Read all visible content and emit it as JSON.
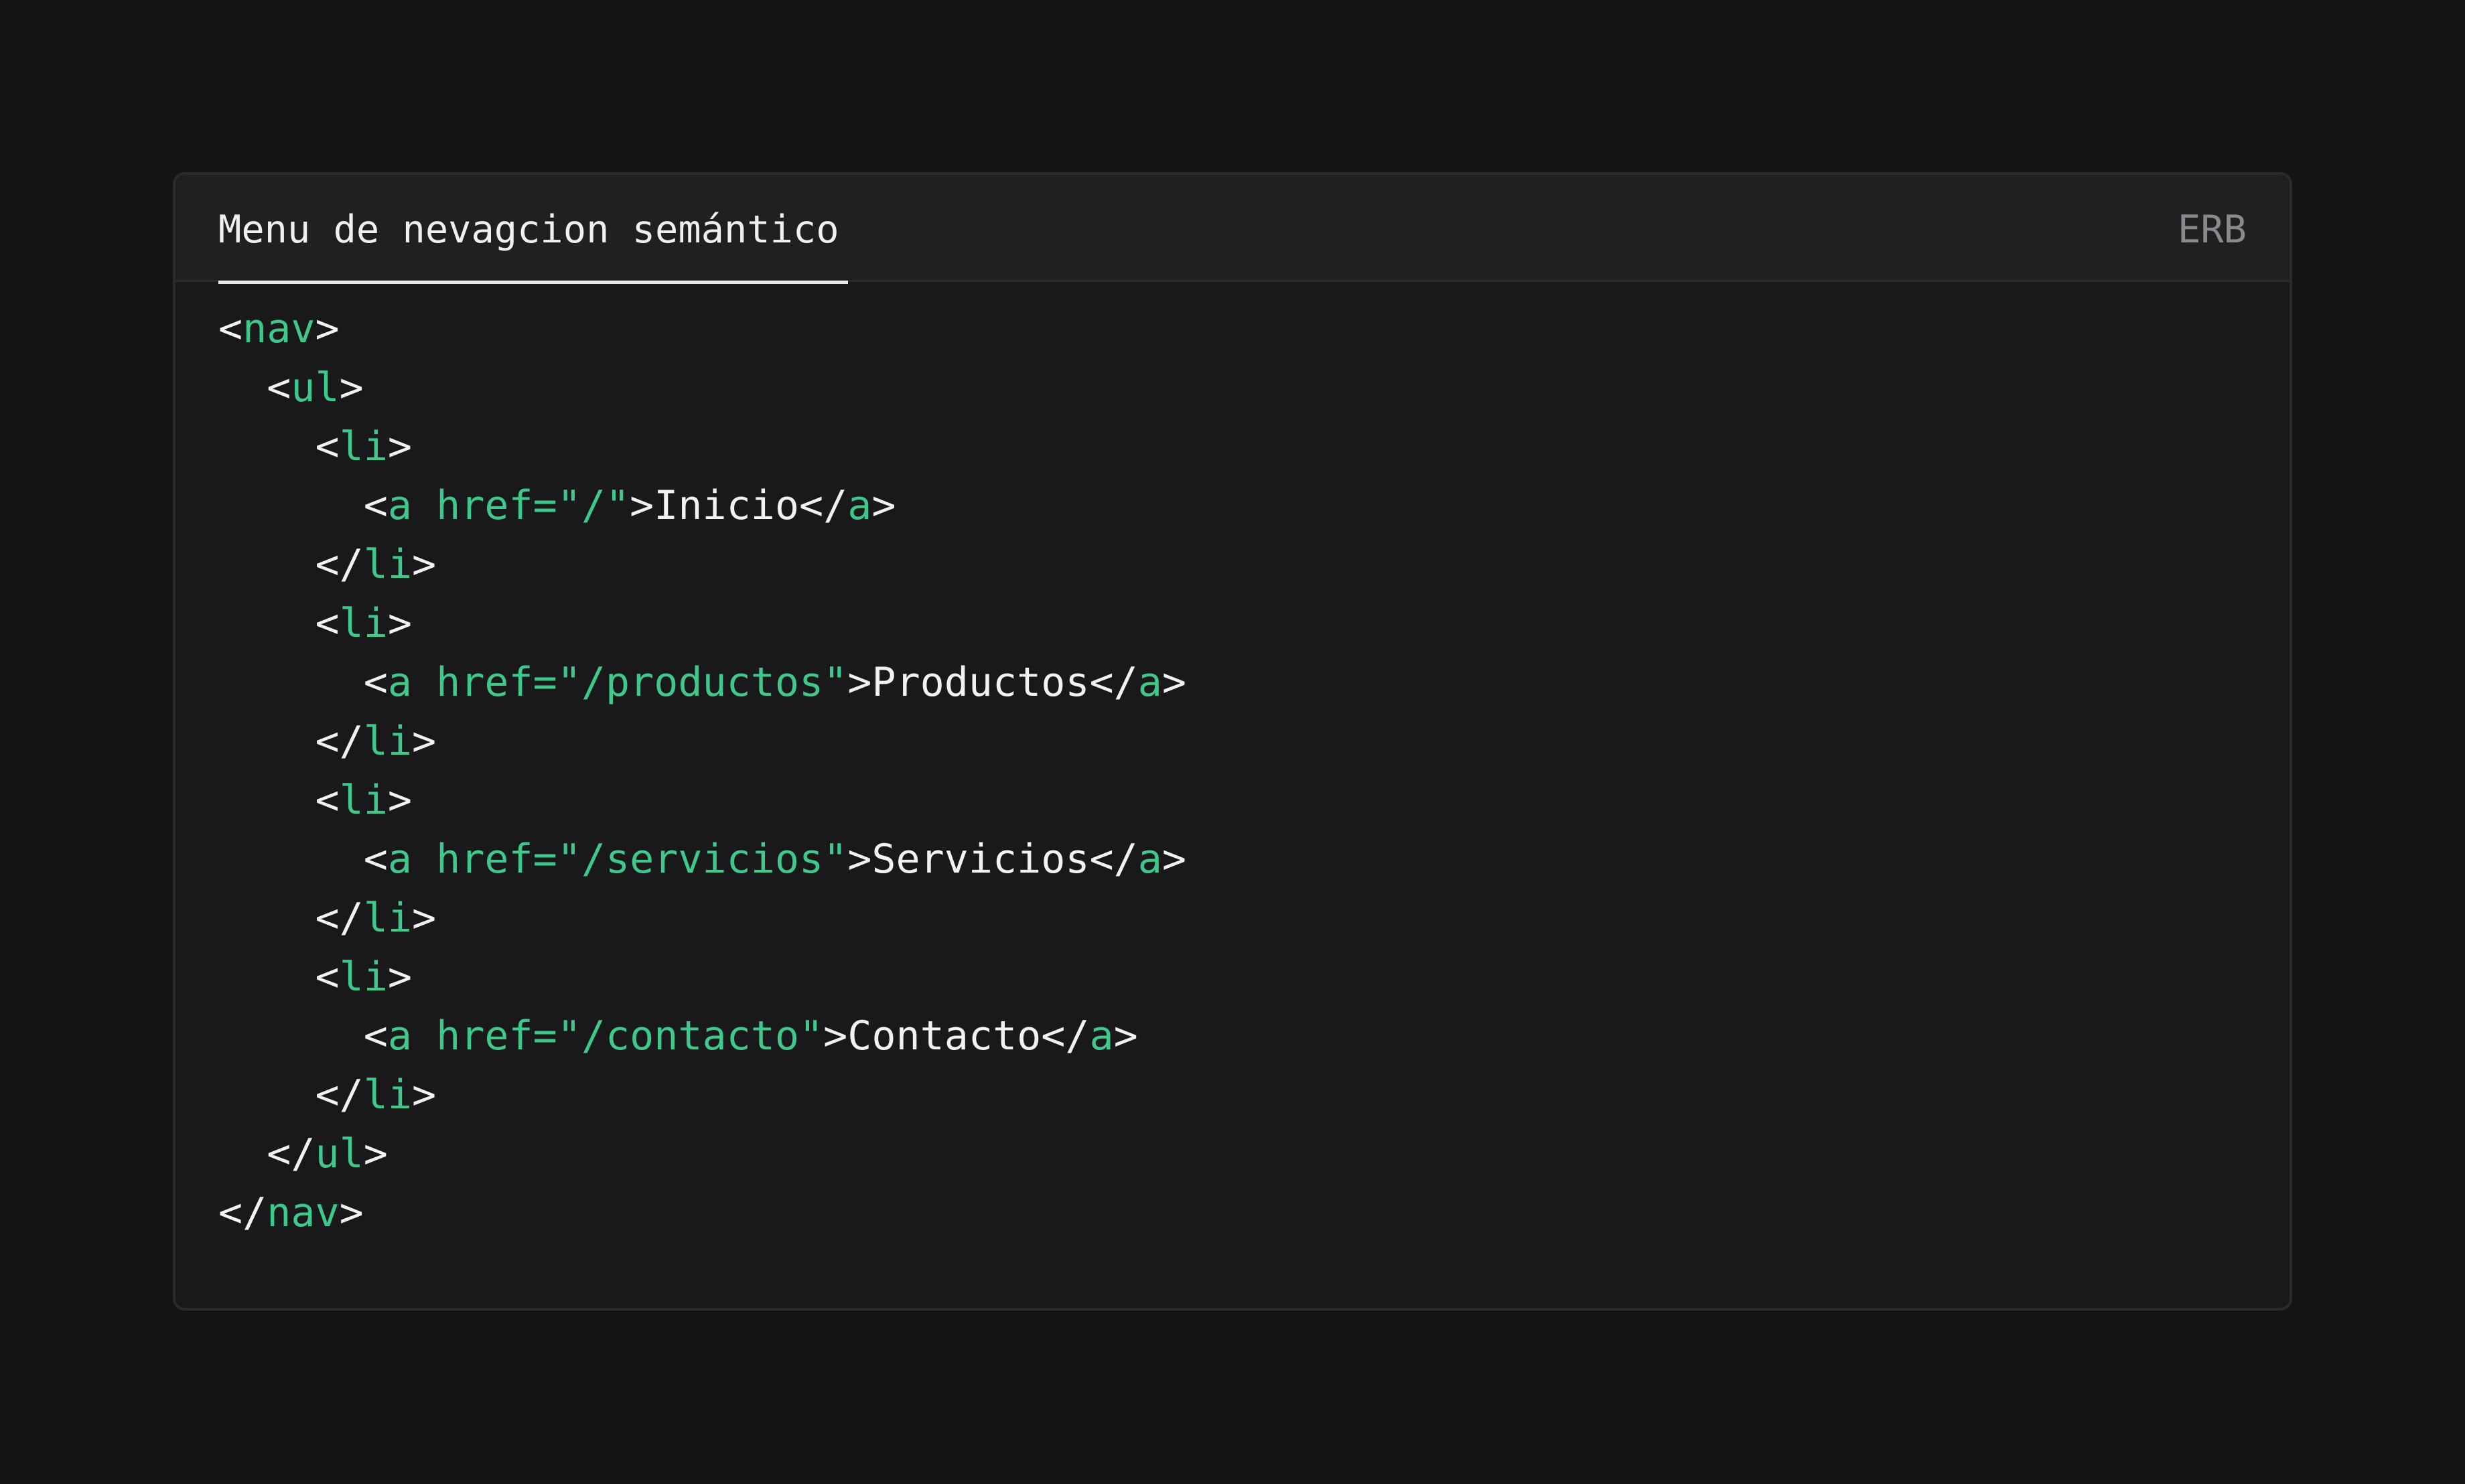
{
  "panel": {
    "title": "Menu de nevagcion semántico",
    "language": "ERB"
  },
  "colors": {
    "background": "#141316",
    "panel": "#19181b",
    "header": "#201f22",
    "tag": "#3ec98a",
    "text": "#f2f1f4",
    "muted": "#8a898e"
  },
  "code": {
    "lines": [
      [
        {
          "t": "p",
          "v": "<"
        },
        {
          "t": "tag",
          "v": "nav"
        },
        {
          "t": "p",
          "v": ">"
        }
      ],
      [
        {
          "t": "p",
          "v": "  <"
        },
        {
          "t": "tag",
          "v": "ul"
        },
        {
          "t": "p",
          "v": ">"
        }
      ],
      [
        {
          "t": "p",
          "v": "    <"
        },
        {
          "t": "tag",
          "v": "li"
        },
        {
          "t": "p",
          "v": ">"
        }
      ],
      [
        {
          "t": "p",
          "v": "      <"
        },
        {
          "t": "tag",
          "v": "a"
        },
        {
          "t": "p",
          "v": " "
        },
        {
          "t": "attr",
          "v": "href="
        },
        {
          "t": "str",
          "v": "\"/\""
        },
        {
          "t": "p",
          "v": ">"
        },
        {
          "t": "text",
          "v": "Inicio"
        },
        {
          "t": "p",
          "v": "</"
        },
        {
          "t": "tag",
          "v": "a"
        },
        {
          "t": "p",
          "v": ">"
        }
      ],
      [
        {
          "t": "p",
          "v": "    </"
        },
        {
          "t": "tag",
          "v": "li"
        },
        {
          "t": "p",
          "v": ">"
        }
      ],
      [
        {
          "t": "p",
          "v": "    <"
        },
        {
          "t": "tag",
          "v": "li"
        },
        {
          "t": "p",
          "v": ">"
        }
      ],
      [
        {
          "t": "p",
          "v": "      <"
        },
        {
          "t": "tag",
          "v": "a"
        },
        {
          "t": "p",
          "v": " "
        },
        {
          "t": "attr",
          "v": "href="
        },
        {
          "t": "str",
          "v": "\"/productos\""
        },
        {
          "t": "p",
          "v": ">"
        },
        {
          "t": "text",
          "v": "Productos"
        },
        {
          "t": "p",
          "v": "</"
        },
        {
          "t": "tag",
          "v": "a"
        },
        {
          "t": "p",
          "v": ">"
        }
      ],
      [
        {
          "t": "p",
          "v": "    </"
        },
        {
          "t": "tag",
          "v": "li"
        },
        {
          "t": "p",
          "v": ">"
        }
      ],
      [
        {
          "t": "p",
          "v": "    <"
        },
        {
          "t": "tag",
          "v": "li"
        },
        {
          "t": "p",
          "v": ">"
        }
      ],
      [
        {
          "t": "p",
          "v": "      <"
        },
        {
          "t": "tag",
          "v": "a"
        },
        {
          "t": "p",
          "v": " "
        },
        {
          "t": "attr",
          "v": "href="
        },
        {
          "t": "str",
          "v": "\"/servicios\""
        },
        {
          "t": "p",
          "v": ">"
        },
        {
          "t": "text",
          "v": "Servicios"
        },
        {
          "t": "p",
          "v": "</"
        },
        {
          "t": "tag",
          "v": "a"
        },
        {
          "t": "p",
          "v": ">"
        }
      ],
      [
        {
          "t": "p",
          "v": "    </"
        },
        {
          "t": "tag",
          "v": "li"
        },
        {
          "t": "p",
          "v": ">"
        }
      ],
      [
        {
          "t": "p",
          "v": "    <"
        },
        {
          "t": "tag",
          "v": "li"
        },
        {
          "t": "p",
          "v": ">"
        }
      ],
      [
        {
          "t": "p",
          "v": "      <"
        },
        {
          "t": "tag",
          "v": "a"
        },
        {
          "t": "p",
          "v": " "
        },
        {
          "t": "attr",
          "v": "href="
        },
        {
          "t": "str",
          "v": "\"/contacto\""
        },
        {
          "t": "p",
          "v": ">"
        },
        {
          "t": "text",
          "v": "Contacto"
        },
        {
          "t": "p",
          "v": "</"
        },
        {
          "t": "tag",
          "v": "a"
        },
        {
          "t": "p",
          "v": ">"
        }
      ],
      [
        {
          "t": "p",
          "v": "    </"
        },
        {
          "t": "tag",
          "v": "li"
        },
        {
          "t": "p",
          "v": ">"
        }
      ],
      [
        {
          "t": "p",
          "v": "  </"
        },
        {
          "t": "tag",
          "v": "ul"
        },
        {
          "t": "p",
          "v": ">"
        }
      ],
      [
        {
          "t": "p",
          "v": "</"
        },
        {
          "t": "tag",
          "v": "nav"
        },
        {
          "t": "p",
          "v": ">"
        }
      ]
    ]
  }
}
